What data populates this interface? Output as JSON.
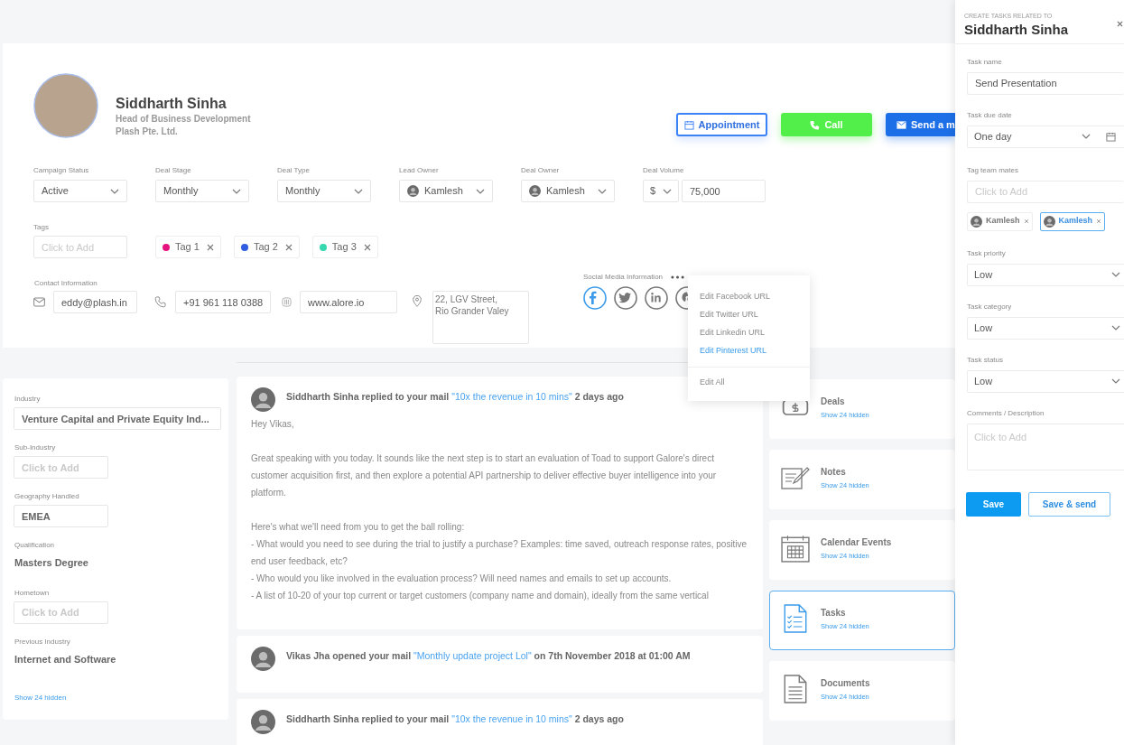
{
  "profile": {
    "name": "Siddharth Sinha",
    "title": "Head of Business Development",
    "company": "Plash Pte. Ltd."
  },
  "actions": [
    {
      "kind": "outline",
      "label": "Appointment"
    },
    {
      "kind": "call",
      "label": "Call"
    },
    {
      "kind": "mail",
      "label": "Send a m"
    }
  ],
  "deal_fields": [
    {
      "kind": "select",
      "label": "Campaign Status",
      "value": "Active"
    },
    {
      "kind": "select",
      "label": "Deal Stage",
      "value": "Monthly"
    },
    {
      "kind": "select",
      "label": "Deal Type",
      "value": "Monthly"
    },
    {
      "kind": "owner",
      "label": "Lead Owner",
      "value": "Kamlesh"
    },
    {
      "kind": "owner",
      "label": "Deal Owner",
      "value": "Kamlesh"
    },
    {
      "kind": "currency",
      "label": "Deal Volume",
      "currency": "$",
      "value": "75,000"
    }
  ],
  "tags": {
    "label": "Tags",
    "placeholder": "Click to Add",
    "items": [
      {
        "label": "Tag 1",
        "color": "#e5127d"
      },
      {
        "label": "Tag 2",
        "color": "#2f5fe0"
      },
      {
        "label": "Tag 3",
        "color": "#36d8b0"
      }
    ]
  },
  "contact": {
    "label": "Contact Information",
    "items": [
      {
        "kind": "email",
        "value": "eddy@plash.in"
      },
      {
        "kind": "phone",
        "value": "+91 961 118 0388"
      },
      {
        "kind": "web",
        "value": "www.alore.io"
      },
      {
        "kind": "address",
        "value": "22, LGV Street,\nRio Grander Valey"
      }
    ]
  },
  "social": {
    "label": "Social Media Information",
    "items": [
      {
        "kind": "facebook",
        "active": true
      },
      {
        "kind": "twitter",
        "active": false
      },
      {
        "kind": "linkedin",
        "active": false
      },
      {
        "kind": "pinterest",
        "active": false
      }
    ]
  },
  "social_menu": {
    "items": [
      {
        "label": "Edit Facebook URL",
        "selected": false
      },
      {
        "label": "Edit Twitter URL",
        "selected": false
      },
      {
        "label": "Edit Linkedin URL",
        "selected": false
      },
      {
        "label": "Edit Pinterest URL",
        "selected": true
      }
    ],
    "footer_items": [
      {
        "label": "Edit All",
        "selected": false
      }
    ]
  },
  "details": {
    "fields": [
      {
        "kind": "field",
        "label": "Industry",
        "value": "Venture Capital and Private Equity Ind..."
      },
      {
        "kind": "field",
        "label": "Sub-Industry",
        "placeholder": "Click to Add"
      },
      {
        "kind": "field",
        "label": "Geography Handled",
        "value": "EMEA"
      },
      {
        "kind": "text",
        "label": "Qualification",
        "value": "Masters Degree"
      },
      {
        "kind": "field",
        "label": "Hometown",
        "placeholder": "Click to Add"
      },
      {
        "kind": "text",
        "label": "Previous Industry",
        "value": "Internet and Software"
      }
    ],
    "link": "Show 24 hidden"
  },
  "feed": [
    {
      "actor": "Siddharth Sinha",
      "action": "replied to your mail",
      "subject": "\"10x the revenue in 10 mins\"",
      "time": "2 days ago",
      "body": [
        "Hey Vikas,",
        "Great speaking with you today. It sounds like the next step is to start an evaluation of Toad to support Galore's direct customer acquisition first, and then explore a potential API partnership to deliver effective buyer intelligence into your platform.",
        "Here's what we'll need from you to get the ball rolling:\n- What would you need to see during the trial to justify a purchase? Examples: time saved, outreach response rates, positive end user feedback, etc?\n- Who would you like involved in the evaluation process? Will need names and emails to set up accounts.\n- A list of 10-20 of your top current or target customers (company name and domain), ideally from the same vertical"
      ]
    },
    {
      "actor": "Vikas Jha",
      "action": "opened your mail",
      "subject": "\"Monthly update project Lol\"",
      "time": "on 7th November 2018 at 01:00 AM"
    },
    {
      "actor": "Siddharth Sinha",
      "action": "replied to your mail",
      "subject": "\"10x the revenue in 10 mins\"",
      "time": "2 days ago"
    }
  ],
  "modules": [
    {
      "kind": "deals",
      "label": "Deals",
      "link": "Show 24 hidden",
      "selected": false
    },
    {
      "kind": "notes",
      "label": "Notes",
      "link": "Show 24 hidden",
      "selected": false
    },
    {
      "kind": "calendar",
      "label": "Calendar Events",
      "link": "Show 24 hidden",
      "selected": false
    },
    {
      "kind": "tasks",
      "label": "Tasks",
      "link": "Show 24 hidden",
      "selected": true
    },
    {
      "kind": "documents",
      "label": "Documents",
      "link": "Show 24 hidden",
      "selected": false
    }
  ],
  "task_panel": {
    "eyebrow": "CREATE TASKS RELATED TO",
    "title": "Siddharth Sinha",
    "fields": [
      {
        "kind": "text",
        "label": "Task name",
        "value": "Send Presentation"
      },
      {
        "kind": "date",
        "label": "Task due date",
        "value": "One day"
      },
      {
        "kind": "text",
        "label": "Tag team mates",
        "placeholder": "Click to Add"
      },
      {
        "kind": "chips",
        "items": [
          {
            "label": "Kamlesh",
            "selected": false
          },
          {
            "label": "Kamlesh",
            "selected": true
          }
        ]
      },
      {
        "kind": "select",
        "label": "Task priority",
        "value": "Low"
      },
      {
        "kind": "select",
        "label": "Task category",
        "value": "Low"
      },
      {
        "kind": "select",
        "label": "Task status",
        "value": "Low"
      },
      {
        "kind": "textarea",
        "label": "Comments / Description",
        "placeholder": "Click to Add"
      }
    ],
    "buttons": [
      {
        "kind": "primary",
        "label": "Save"
      },
      {
        "kind": "outline",
        "label": "Save & send"
      }
    ]
  }
}
